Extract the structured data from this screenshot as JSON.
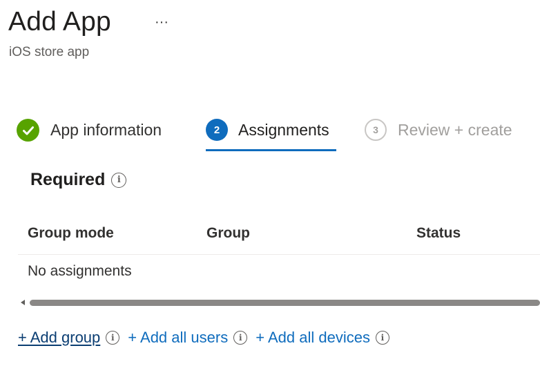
{
  "header": {
    "title": "Add App",
    "more_label": "···",
    "subtitle": "iOS store app"
  },
  "wizard": {
    "steps": [
      {
        "number": "1",
        "label": "App information",
        "state": "completed"
      },
      {
        "number": "2",
        "label": "Assignments",
        "state": "active"
      },
      {
        "number": "3",
        "label": "Review + create",
        "state": "upcoming"
      }
    ]
  },
  "section": {
    "heading": "Required",
    "info_glyph": "i"
  },
  "table": {
    "columns": [
      "Group mode",
      "Group",
      "Status"
    ],
    "empty_text": "No assignments"
  },
  "actions": {
    "add_group": "+ Add group",
    "add_all_users": "+ Add all users",
    "add_all_devices": "+ Add all devices"
  },
  "colors": {
    "accent": "#0f6cbd",
    "success": "#57a300",
    "link": "#0f6cbd",
    "muted": "#a19f9d"
  },
  "icons": {
    "completed_step": "checkmark-icon",
    "info": "info-icon",
    "more": "ellipsis-icon",
    "scroll_left": "chevron-left-icon"
  }
}
